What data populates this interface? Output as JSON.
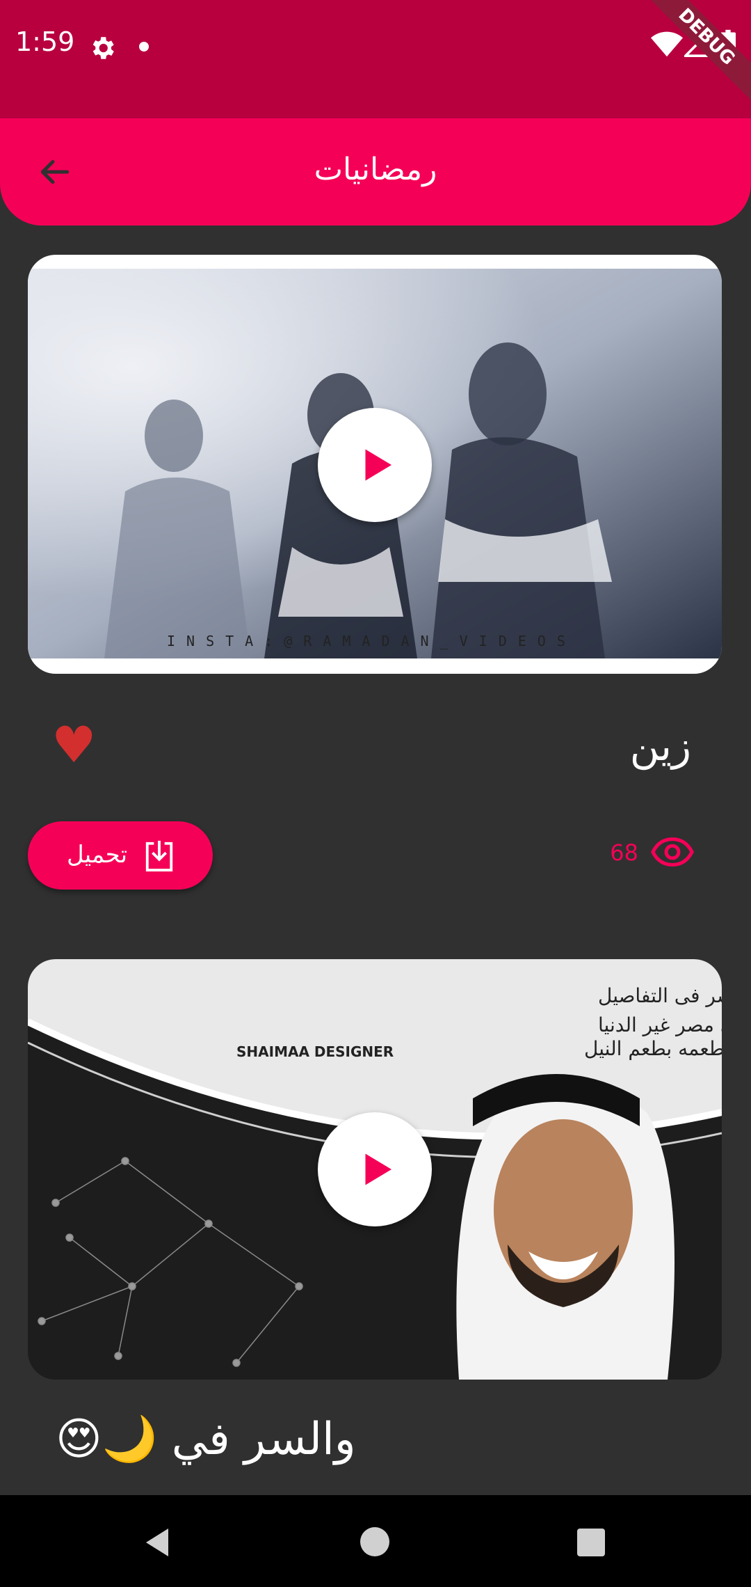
{
  "status_bar": {
    "time": "1:59",
    "debug_label": "DEBUG",
    "color": "#b8003f"
  },
  "app_bar": {
    "title": "رمضانيات",
    "color": "#f50057",
    "back_icon": "arrow-left-icon"
  },
  "videos": [
    {
      "title": "زين",
      "views": "68",
      "download_label": "تحميل",
      "liked": true,
      "thumbnail_watermark": "INSTA:@RAMADAN_VIDEOS"
    },
    {
      "caption": "والسر في 🌙😍",
      "thumbnail_lines": [
        "والسر فى التفاصيل",
        "رمضان فى مصر غير الدنيا",
        "طعمه بطعم النيل"
      ],
      "thumbnail_brand": "SHAIMAA DESIGNER"
    }
  ],
  "colors": {
    "accent": "#f50057",
    "background": "#303030",
    "heart": "#d32f2f"
  }
}
